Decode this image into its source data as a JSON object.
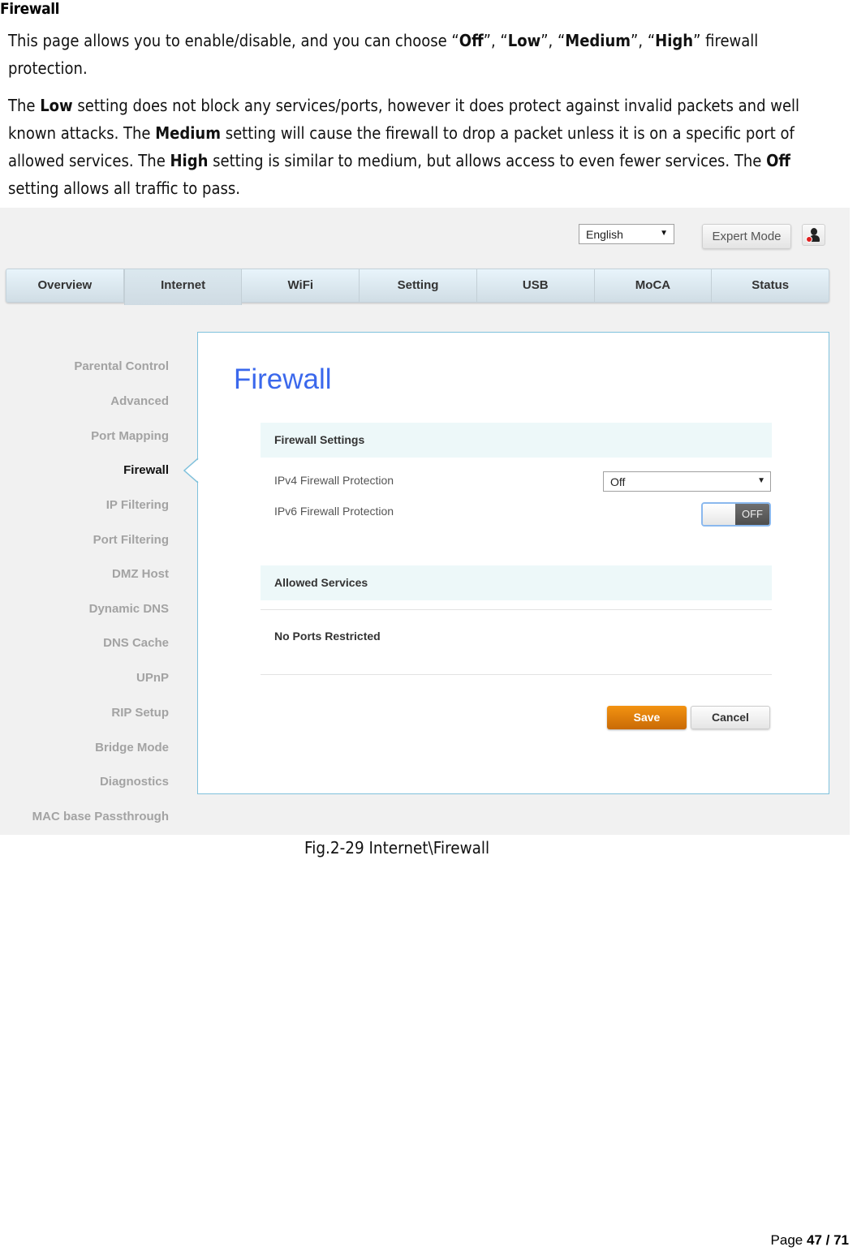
{
  "document": {
    "heading": "Firewall",
    "paragraph1": {
      "t1": "This page allows you to enable/disable, and you can choose “",
      "b1": "Off",
      "t2": "”, “",
      "b2": "Low",
      "t3": "”, “",
      "b3": "Medium",
      "t4": "”, “",
      "b4": "High",
      "t5": "” firewall protection."
    },
    "paragraph2": {
      "t1": "The ",
      "b1": "Low",
      "t2": " setting does not block any services/ports, however it does protect against invalid packets and well known attacks. The ",
      "b2": "Medium",
      "t3": " setting will cause the firewall to drop a packet unless it is on a specific port of allowed services. The ",
      "b3": "High",
      "t4": " setting is similar to medium, but allows access to even fewer services. The ",
      "b4": "Off",
      "t5": " setting allows all traffic to pass."
    },
    "caption": "Fig.2-29 Internet\\Firewall",
    "footer": {
      "label": "Page ",
      "current": "47",
      "separator": " / ",
      "total": "71"
    }
  },
  "ui": {
    "language_select": {
      "value": "English",
      "arrow": "▼"
    },
    "expert_mode_label": "Expert Mode",
    "user_icon": "user-logout-icon",
    "nav_tabs": [
      {
        "label": "Overview"
      },
      {
        "label": "Internet",
        "active": true
      },
      {
        "label": "WiFi"
      },
      {
        "label": "Setting"
      },
      {
        "label": "USB"
      },
      {
        "label": "MoCA"
      },
      {
        "label": "Status"
      }
    ],
    "sidebar": [
      {
        "label": "Parental Control"
      },
      {
        "label": "Advanced"
      },
      {
        "label": "Port Mapping"
      },
      {
        "label": "Firewall",
        "active": true
      },
      {
        "label": "IP Filtering"
      },
      {
        "label": "Port Filtering"
      },
      {
        "label": "DMZ Host"
      },
      {
        "label": "Dynamic DNS"
      },
      {
        "label": "DNS Cache"
      },
      {
        "label": "UPnP"
      },
      {
        "label": "RIP Setup"
      },
      {
        "label": "Bridge Mode"
      },
      {
        "label": "Diagnostics"
      },
      {
        "label": "MAC base Passthrough"
      }
    ],
    "panel": {
      "title": "Firewall",
      "firewall_settings_header": "Firewall Settings",
      "ipv4_label": "IPv4 Firewall Protection",
      "ipv4_value": "Off",
      "ipv6_label": "IPv6 Firewall Protection",
      "ipv6_toggle_state": "OFF",
      "allowed_services_header": "Allowed Services",
      "allowed_services_value": "No Ports Restricted",
      "save_label": "Save",
      "cancel_label": "Cancel"
    },
    "colors": {
      "title_blue": "#3b68ec",
      "save_orange": "#e67e0c",
      "panel_border": "#7fc1dc",
      "section_bg": "#edf8f9"
    }
  }
}
